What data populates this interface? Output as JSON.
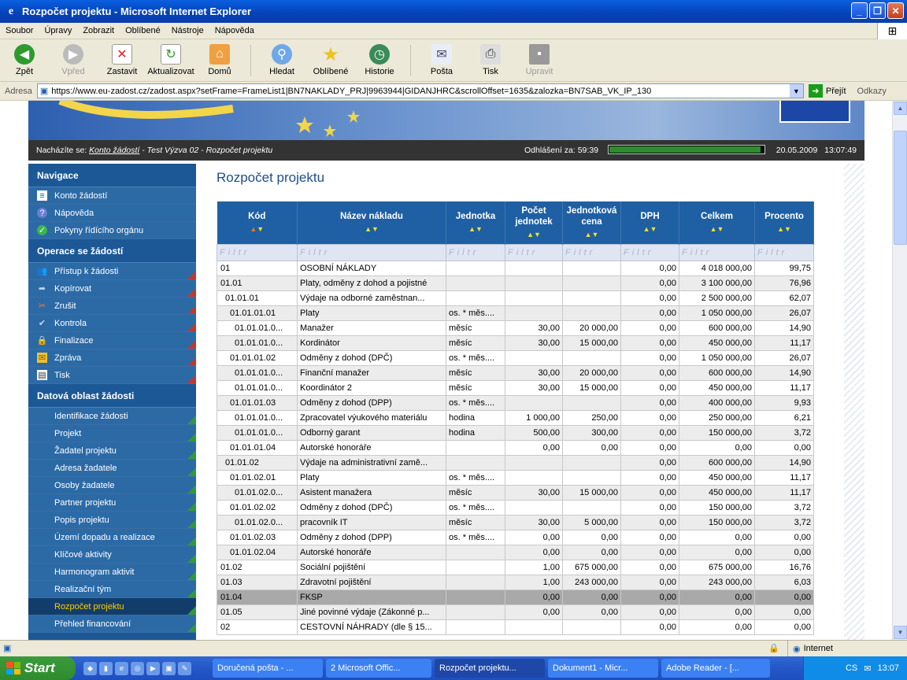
{
  "window": {
    "title": "Rozpočet projektu - Microsoft Internet Explorer"
  },
  "menu": [
    "Soubor",
    "Úpravy",
    "Zobrazit",
    "Oblíbené",
    "Nástroje",
    "Nápověda"
  ],
  "toolbar": {
    "back": "Zpět",
    "forward": "Vpřed",
    "stop": "Zastavit",
    "refresh": "Aktualizovat",
    "home": "Domů",
    "search": "Hledat",
    "favorites": "Oblíbené",
    "history": "Historie",
    "mail": "Pošta",
    "print": "Tisk",
    "edit": "Upravit"
  },
  "address": {
    "label": "Adresa",
    "url": "https://www.eu-zadost.cz/zadost.aspx?setFrame=FrameList1|BN7NAKLADY_PRJ|9963944|GIDANJHRC&scrollOffset=1635&zalozka=BN7SAB_VK_IP_130",
    "go": "Přejít",
    "links": "Odkazy"
  },
  "breadcrumb": {
    "prefix": "Nacházíte se:",
    "link": "Konto žádostí",
    "rest": " - Test Výzva 02 - Rozpočet projektu",
    "logout_label": "Odhlášení za:",
    "logout_time": "59:39",
    "session_fraction": 0.98,
    "date": "20.05.2009",
    "time": "13:07:49"
  },
  "sidebar": {
    "nav_title": "Navigace",
    "nav": [
      "Konto žádostí",
      "Nápověda",
      "Pokyny řídícího orgánu"
    ],
    "ops_title": "Operace se žádostí",
    "ops": [
      "Přístup k žádosti",
      "Kopírovat",
      "Zrušit",
      "Kontrola",
      "Finalizace",
      "Zpráva",
      "Tisk"
    ],
    "data_title": "Datová oblast žádosti",
    "data": [
      "Identifikace žádosti",
      "Projekt",
      "Žadatel projektu",
      "Adresa žadatele",
      "Osoby žadatele",
      "Partner projektu",
      "Popis projektu",
      "Území dopadu a realizace",
      "Klíčové aktivity",
      "Harmonogram aktivit",
      "Realizační tým",
      "Rozpočet projektu",
      "Přehled financování"
    ],
    "active": "Rozpočet projektu"
  },
  "page": {
    "title": "Rozpočet projektu"
  },
  "table": {
    "headers": [
      "Kód",
      "Název nákladu",
      "Jednotka",
      "Počet jednotek",
      "Jednotková cena",
      "DPH",
      "Celkem",
      "Procento"
    ],
    "filter": "Filtr",
    "rows": [
      [
        "01",
        "OSOBNÍ NÁKLADY",
        "",
        "",
        "",
        "0,00",
        "4 018 000,00",
        "99,75"
      ],
      [
        "01.01",
        "Platy, odměny z dohod a pojistné",
        "",
        "",
        "",
        "0,00",
        "3 100 000,00",
        "76,96"
      ],
      [
        "01.01.01",
        "Výdaje na odborné zaměstnan...",
        "",
        "",
        "",
        "0,00",
        "2 500 000,00",
        "62,07"
      ],
      [
        "01.01.01.01",
        "Platy",
        "os. * měs....",
        "",
        "",
        "0,00",
        "1 050 000,00",
        "26,07"
      ],
      [
        "01.01.01.0...",
        "Manažer",
        "měsíc",
        "30,00",
        "20 000,00",
        "0,00",
        "600 000,00",
        "14,90"
      ],
      [
        "01.01.01.0...",
        "Kordinátor",
        "měsíc",
        "30,00",
        "15 000,00",
        "0,00",
        "450 000,00",
        "11,17"
      ],
      [
        "01.01.01.02",
        "Odměny z dohod (DPČ)",
        "os. * měs....",
        "",
        "",
        "0,00",
        "1 050 000,00",
        "26,07"
      ],
      [
        "01.01.01.0...",
        "Finanční manažer",
        "měsíc",
        "30,00",
        "20 000,00",
        "0,00",
        "600 000,00",
        "14,90"
      ],
      [
        "01.01.01.0...",
        "Koordinátor 2",
        "měsíc",
        "30,00",
        "15 000,00",
        "0,00",
        "450 000,00",
        "11,17"
      ],
      [
        "01.01.01.03",
        "Odměny z dohod (DPP)",
        "os. * měs....",
        "",
        "",
        "0,00",
        "400 000,00",
        "9,93"
      ],
      [
        "01.01.01.0...",
        "Zpracovatel výukového materiálu",
        "hodina",
        "1 000,00",
        "250,00",
        "0,00",
        "250 000,00",
        "6,21"
      ],
      [
        "01.01.01.0...",
        "Odborný garant",
        "hodina",
        "500,00",
        "300,00",
        "0,00",
        "150 000,00",
        "3,72"
      ],
      [
        "01.01.01.04",
        "Autorské honoráře",
        "",
        "0,00",
        "0,00",
        "0,00",
        "0,00",
        "0,00"
      ],
      [
        "01.01.02",
        "Výdaje na administrativní zamě...",
        "",
        "",
        "",
        "0,00",
        "600 000,00",
        "14,90"
      ],
      [
        "01.01.02.01",
        "Platy",
        "os. * měs....",
        "",
        "",
        "0,00",
        "450 000,00",
        "11,17"
      ],
      [
        "01.01.02.0...",
        "Asistent manažera",
        "měsíc",
        "30,00",
        "15 000,00",
        "0,00",
        "450 000,00",
        "11,17"
      ],
      [
        "01.01.02.02",
        "Odměny z dohod (DPČ)",
        "os. * měs....",
        "",
        "",
        "0,00",
        "150 000,00",
        "3,72"
      ],
      [
        "01.01.02.0...",
        "pracovník IT",
        "měsíc",
        "30,00",
        "5 000,00",
        "0,00",
        "150 000,00",
        "3,72"
      ],
      [
        "01.01.02.03",
        "Odměny z dohod (DPP)",
        "os. * měs....",
        "0,00",
        "0,00",
        "0,00",
        "0,00",
        "0,00"
      ],
      [
        "01.01.02.04",
        "Autorské honoráře",
        "",
        "0,00",
        "0,00",
        "0,00",
        "0,00",
        "0,00"
      ],
      [
        "01.02",
        "Sociální pojištění",
        "",
        "1,00",
        "675 000,00",
        "0,00",
        "675 000,00",
        "16,76"
      ],
      [
        "01.03",
        "Zdravotní pojištění",
        "",
        "1,00",
        "243 000,00",
        "0,00",
        "243 000,00",
        "6,03"
      ],
      [
        "01.04",
        "FKSP",
        "",
        "0,00",
        "0,00",
        "0,00",
        "0,00",
        "0,00"
      ],
      [
        "01.05",
        "Jiné povinné výdaje (Zákonné p...",
        "",
        "0,00",
        "0,00",
        "0,00",
        "0,00",
        "0,00"
      ],
      [
        "02",
        "CESTOVNÍ NÁHRADY (dle § 15...",
        "",
        "",
        "",
        "0,00",
        "0,00",
        "0,00"
      ]
    ]
  },
  "status": {
    "zone": "Internet"
  },
  "taskbar": {
    "start": "Start",
    "tasks": [
      "Doručená pošta - ...",
      "2 Microsoft Offic...",
      "Rozpočet projektu...",
      "Dokument1 - Micr...",
      "Adobe Reader - [..."
    ],
    "lang": "CS",
    "clock": "13:07"
  }
}
